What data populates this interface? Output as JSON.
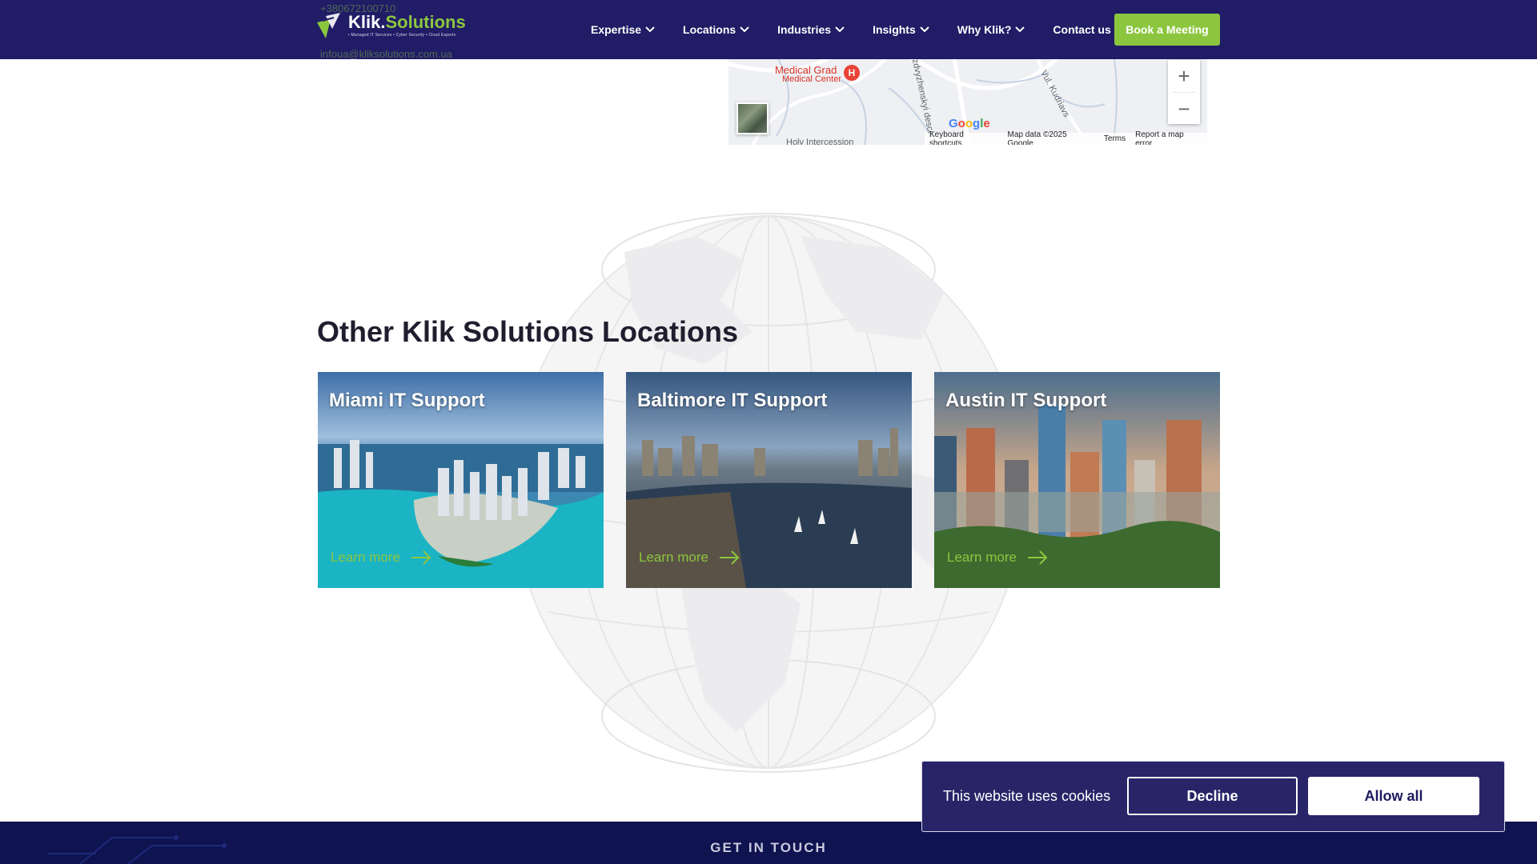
{
  "header": {
    "logo_main": "Klik.",
    "logo_accent": "Solutions",
    "logo_tagline": "• Managed IT Services • Cyber Security • Cloud Experts",
    "phone": "+380672100710",
    "email": "infoua@kliksolutions.com.ua",
    "nav": [
      {
        "label": "Expertise"
      },
      {
        "label": "Locations"
      },
      {
        "label": "Industries"
      },
      {
        "label": "Insights"
      },
      {
        "label": "Why Klik?"
      },
      {
        "label": "Contact us"
      }
    ],
    "cta": "Book a Meeting"
  },
  "map": {
    "poi_name": "Medical Grad",
    "poi_sub": "Medical Center",
    "poi_small": "Medical Center",
    "road_1": "Vozdvyzhenskyi descent",
    "road_2": "Vul. Kudriavs",
    "road_3": "Holy Intercession",
    "zoom_in": "+",
    "zoom_out": "−",
    "google": "Google",
    "footer": [
      "Keyboard shortcuts",
      "Map data ©2025 Google",
      "Terms",
      "Report a map error"
    ]
  },
  "section": {
    "title": "Other Klik Solutions Locations",
    "cards": [
      {
        "title": "Miami IT Support",
        "link": "Learn more"
      },
      {
        "title": "Baltimore IT Support",
        "link": "Learn more"
      },
      {
        "title": "Austin IT Support",
        "link": "Learn more"
      }
    ]
  },
  "cookie": {
    "text": "This website uses cookies",
    "decline": "Decline",
    "allow": "Allow all"
  },
  "footer": {
    "title": "GET IN TOUCH"
  },
  "colors": {
    "brand_navy": "#201c66",
    "accent_green": "#8cc63f",
    "cookie_bg": "#272568",
    "footer_bg": "#0f1350"
  }
}
